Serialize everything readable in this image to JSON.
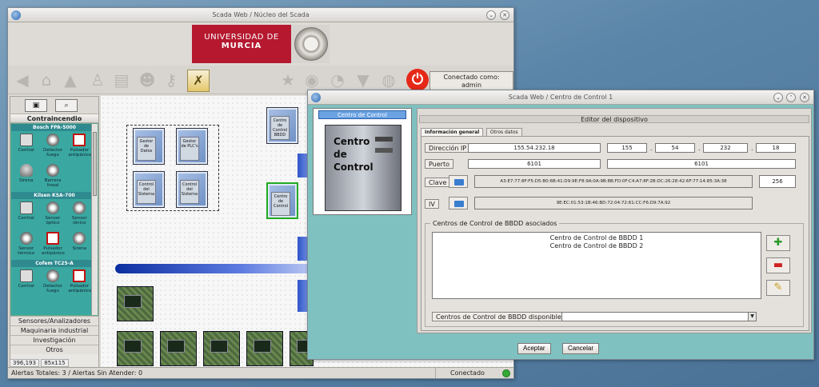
{
  "main": {
    "title": "Scada Web / Núcleo del Scada",
    "banner_l1": "UNIVERSIDAD DE",
    "banner_l2": "MURCIA",
    "conectado_label": "Conectado como:",
    "user": "admin",
    "palette": {
      "section_top": "Contraincendio",
      "groups": [
        {
          "name": "Bosch FPA-5000",
          "items": [
            "Central",
            "Detector fuego",
            "Pulsador antipánico"
          ],
          "items2": [
            "Sirena",
            "Barrera lineal"
          ]
        },
        {
          "name": "Kilsen KSA-700",
          "items": [
            "Central",
            "Sensor óptico",
            "Sensor iónico"
          ],
          "items2": [
            "Sensor térmico",
            "Pulsador antipánico",
            "Sirena"
          ]
        },
        {
          "name": "Cofem TC25-A",
          "items": [
            "Central",
            "Detector fuego",
            "Pulsador antipánico"
          ]
        }
      ],
      "menus": [
        "Sensores/Analizadores",
        "Maquinaria industrial",
        "Investigación",
        "Otros"
      ]
    },
    "coords": "396,193",
    "size": "85x115",
    "nodes": {
      "gestor_datos": "Gestor de Datos",
      "gestor_plc": "Gestor de PLC's",
      "control_sistema_1": "Control del Sistema",
      "control_sistema_2": "Control del Sistema",
      "control_bbdd": "Centro de Control BBDD",
      "centro_control": "Centro de Control"
    },
    "alerts": "Alertas Totales: 3 / Alertas Sin Atender: 0",
    "status": "Conectado"
  },
  "dialog": {
    "title": "Scada Web / Centro de Control 1",
    "left_header": "Centro de Control",
    "tower_text": [
      "Centro",
      "de",
      "Control"
    ],
    "editor_title": "Editor del dispositivo",
    "tabs": [
      "Información general",
      "Otros datos"
    ],
    "ip_label": "Dirección IP",
    "ip_value": "155.54.232.18",
    "ip_parts": [
      "155",
      "54",
      "232",
      "18"
    ],
    "port_label": "Puerto",
    "port_value": "6101",
    "port_value2": "6101",
    "key_label": "Clave",
    "key_value": "A3:E7:77:8F:F5:D5:B0:6B:41:D9:9E:F8:9A:0A:9B:8B:FD:0F:C4:A7:8F:2B:DC:26:28:42:6F:77:14:85:3A:38",
    "key_bits": "256",
    "iv_label": "IV",
    "iv_value": "9E:EC:01:53:1B:46:BD:72:04:72:61:CC:F6:D9:7A:92",
    "assoc_legend": "Centros de Control de BBDD asociados",
    "assoc_items": [
      "Centro de Control de BBDD 1",
      "Centro de Control de BBDD 2"
    ],
    "avail_label": "Centros de Control de BBDD disponibles",
    "accept": "Aceptar",
    "cancel": "Cancelar"
  }
}
